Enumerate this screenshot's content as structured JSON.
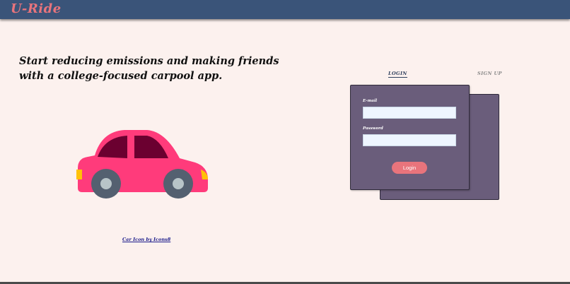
{
  "app": {
    "logo": "U-Ride"
  },
  "hero": {
    "headline_line1": "Start reducing emissions and making friends",
    "headline_line2": "with a college-focused carpool app.",
    "icon": "car-icon",
    "credit_link": "Car Icon by Icons8"
  },
  "auth": {
    "tabs": [
      {
        "label": "LOGIN",
        "active": true
      },
      {
        "label": "SIGN UP",
        "active": false
      }
    ],
    "email_label": "E-mail",
    "email_value": "",
    "password_label": "Password",
    "password_value": "",
    "submit_label": "Login"
  },
  "colors": {
    "navbar": "#3a5479",
    "logo": "#e8747c",
    "background": "#fcf1ee",
    "card": "#6a5d7b",
    "button": "#e8747c",
    "car_body": "#ff3b7b",
    "car_window": "#6b0030"
  }
}
